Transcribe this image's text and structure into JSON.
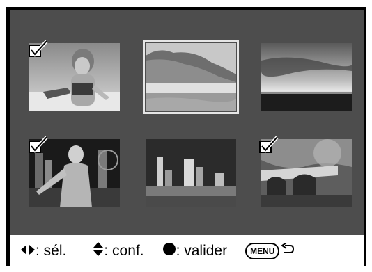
{
  "thumbnails": [
    {
      "subject": "child on beach",
      "checked": true,
      "selected": false
    },
    {
      "subject": "coastal cliff seascape",
      "checked": false,
      "selected": true
    },
    {
      "subject": "sunset over sea",
      "checked": false,
      "selected": false
    },
    {
      "subject": "woman at night city",
      "checked": true,
      "selected": false
    },
    {
      "subject": "night skyline",
      "checked": false,
      "selected": false
    },
    {
      "subject": "stone bridge",
      "checked": true,
      "selected": false
    }
  ],
  "footer": {
    "select_label": ": sél.",
    "confirm_label": ": conf.",
    "validate_label": ": valider",
    "menu_label": "MENU"
  },
  "colors": {
    "screen_bg": "#4d4d4d",
    "frame": "#000000",
    "footer_bg": "#ffffff",
    "selection": "#e6e6e6"
  }
}
